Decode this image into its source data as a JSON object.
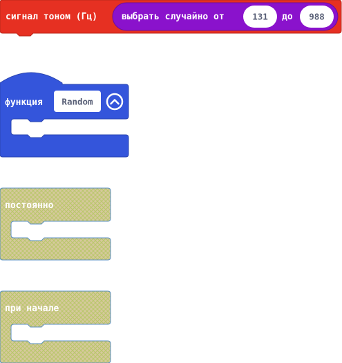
{
  "colors": {
    "music_block": "#e63022",
    "music_block_border": "#b8271b",
    "math_block": "#8a12cc",
    "math_block_border": "#6a0e9e",
    "function_block": "#3455db",
    "function_block_border": "#2a45b0",
    "disabled_block_pattern": "#c9c96a",
    "disabled_block_fill": "#d8c8a0",
    "disabled_block_border": "#5a8fc0",
    "field_bg": "#ffffff",
    "field_text": "#575e75"
  },
  "blocks": {
    "tone_block": {
      "label": "сигнал тоном (Гц)",
      "random_block": {
        "label_prefix": "выбрать случайно от",
        "from_value": "131",
        "label_middle": "до",
        "to_value": "988"
      }
    },
    "function_block": {
      "label": "функция",
      "name_value": "Random",
      "collapse_icon": "chevron-up-circle-icon"
    },
    "forever_block": {
      "label": "постоянно"
    },
    "on_start_block": {
      "label": "при начале"
    }
  }
}
